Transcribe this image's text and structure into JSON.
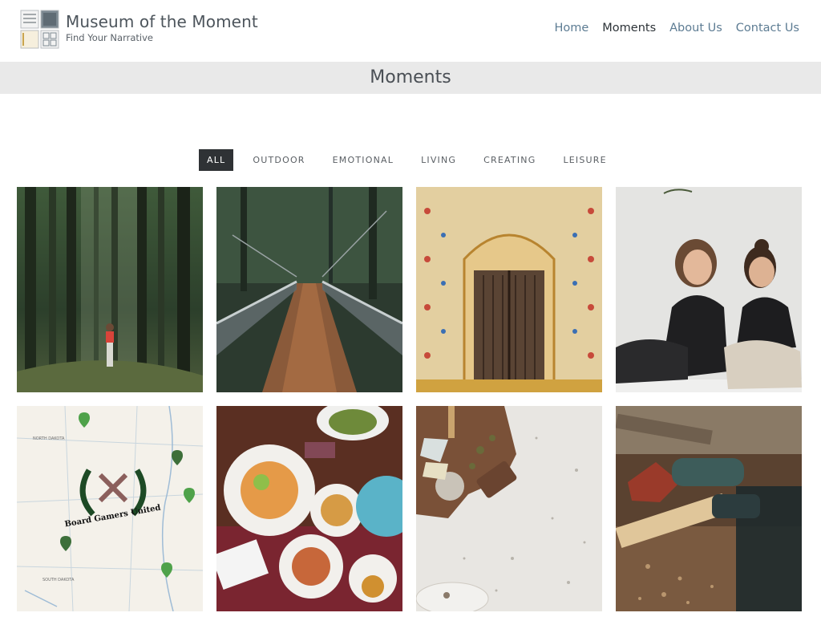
{
  "site": {
    "title": "Museum of the Moment",
    "tagline": "Find Your Narrative"
  },
  "nav": {
    "items": [
      {
        "label": "Home"
      },
      {
        "label": "Moments",
        "active": true
      },
      {
        "label": "About Us"
      },
      {
        "label": "Contact Us"
      }
    ]
  },
  "page": {
    "title": "Moments"
  },
  "filters": {
    "items": [
      {
        "label": "ALL",
        "active": true
      },
      {
        "label": "OUTDOOR"
      },
      {
        "label": "EMOTIONAL"
      },
      {
        "label": "LIVING"
      },
      {
        "label": "CREATING"
      },
      {
        "label": "LEISURE"
      }
    ]
  },
  "gallery": {
    "items": [
      {
        "subject": "forest-walk-photo"
      },
      {
        "subject": "suspension-bridge-photo"
      },
      {
        "subject": "ornate-door-photo"
      },
      {
        "subject": "laughing-friends-photo"
      },
      {
        "subject": "board-gamers-map-photo",
        "map_labels": [
          "NORTH DAKOTA",
          "SOUTH DAKOTA"
        ],
        "logo_text": "Board Gamers United"
      },
      {
        "subject": "dinner-table-photo"
      },
      {
        "subject": "cheese-board-photo"
      },
      {
        "subject": "woodworking-sander-photo"
      }
    ]
  },
  "colors": {
    "nav_link": "#5d7c93",
    "nav_active": "#2d3338",
    "band": "#e9e9e9",
    "filter_active_bg": "#2f3235"
  }
}
